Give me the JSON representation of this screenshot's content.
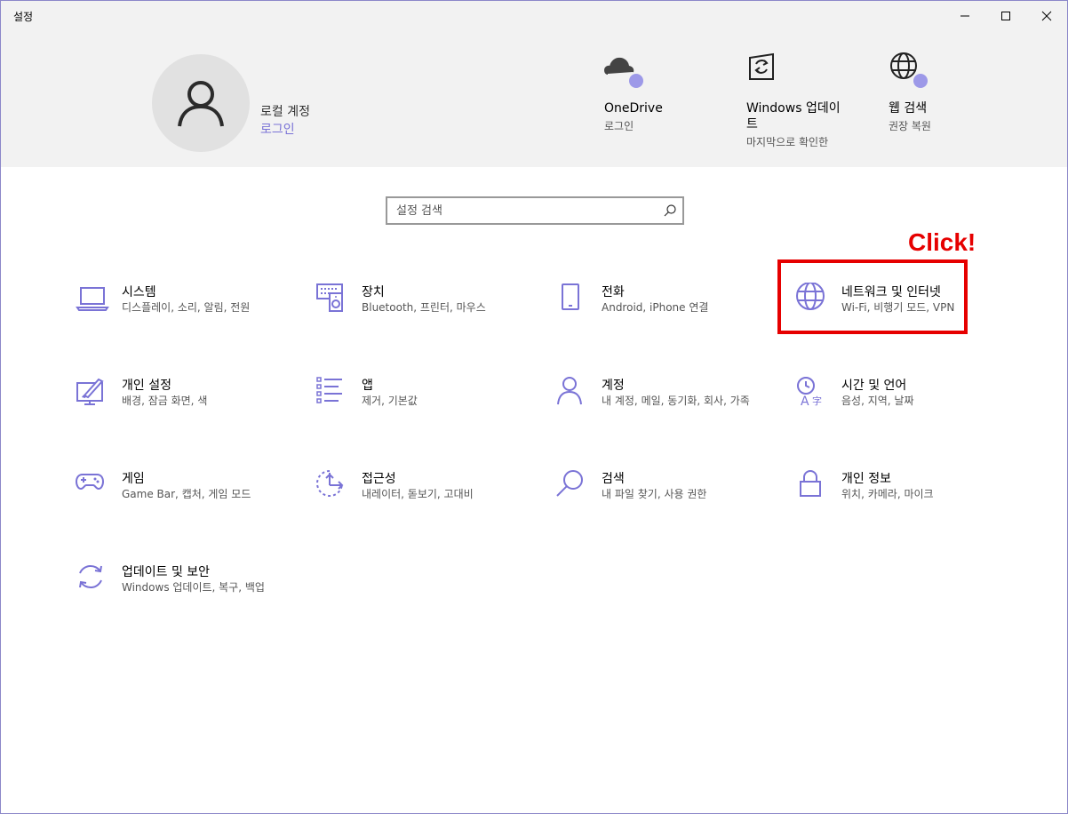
{
  "window": {
    "title": "설정"
  },
  "account": {
    "name": "로컬 계정",
    "link": "로그인"
  },
  "quick_links": [
    {
      "title": "OneDrive",
      "subtitle": "로그인",
      "icon": "cloud-icon"
    },
    {
      "title": "Windows 업데이트",
      "subtitle": "마지막으로 확인한",
      "icon": "update-icon"
    },
    {
      "title": "웹 검색",
      "subtitle": "권장 복원",
      "icon": "globe-icon"
    }
  ],
  "search": {
    "placeholder": "설정 검색"
  },
  "categories": [
    {
      "label": "시스템",
      "desc": "디스플레이, 소리, 알림, 전원",
      "icon": "laptop-icon"
    },
    {
      "label": "장치",
      "desc": "Bluetooth, 프린터, 마우스",
      "icon": "devices-icon"
    },
    {
      "label": "전화",
      "desc": "Android, iPhone 연결",
      "icon": "phone-icon"
    },
    {
      "label": "네트워크 및 인터넷",
      "desc": "Wi-Fi, 비행기 모드, VPN",
      "icon": "globe-icon"
    },
    {
      "label": "개인 설정",
      "desc": "배경, 잠금 화면, 색",
      "icon": "personalization-icon"
    },
    {
      "label": "앱",
      "desc": "제거, 기본값",
      "icon": "apps-list-icon"
    },
    {
      "label": "계정",
      "desc": "내 계정, 메일, 동기화, 회사, 가족",
      "icon": "person-icon"
    },
    {
      "label": "시간 및 언어",
      "desc": "음성, 지역, 날짜",
      "icon": "time-language-icon"
    },
    {
      "label": "게임",
      "desc": "Game Bar, 캡처, 게임 모드",
      "icon": "gamepad-icon"
    },
    {
      "label": "접근성",
      "desc": "내레이터, 돋보기, 고대비",
      "icon": "accessibility-icon"
    },
    {
      "label": "검색",
      "desc": "내 파일 찾기, 사용 권한",
      "icon": "search-icon"
    },
    {
      "label": "개인 정보",
      "desc": "위치, 카메라, 마이크",
      "icon": "lock-icon"
    },
    {
      "label": "업데이트 및 보안",
      "desc": "Windows 업데이트, 복구, 백업",
      "icon": "update-icon"
    }
  ],
  "annotation": {
    "text": "Click!"
  },
  "colors": {
    "accent": "#7a73d6",
    "header_bg": "#f2f2f2",
    "annotation": "#e60000"
  }
}
